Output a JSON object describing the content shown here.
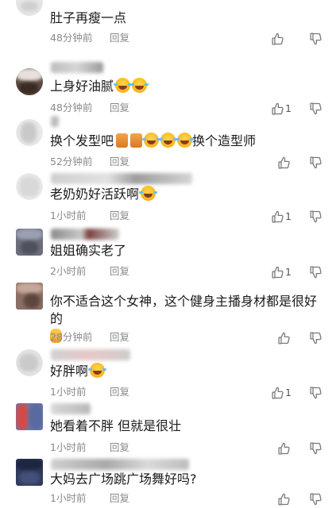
{
  "comments": [
    {
      "text": "肚子再瘦一点",
      "time": "48分钟前",
      "reply": "回复",
      "likes": ""
    },
    {
      "text": "上身好油腻",
      "time": "48分钟前",
      "reply": "回复",
      "likes": "1"
    },
    {
      "text_a": "换个发型吧",
      "text_b": "换个造型师",
      "time": "52分钟前",
      "reply": "回复",
      "likes": ""
    },
    {
      "text": "老奶奶好活跃啊",
      "time": "1小时前",
      "reply": "回复",
      "likes": "1"
    },
    {
      "text": "姐姐确实老了",
      "time": "2小时前",
      "reply": "回复",
      "likes": "1"
    },
    {
      "text": "你不适合这个女神，这个健身主播身材都是很好的",
      "time": "28分钟前",
      "reply": "回复",
      "likes": ""
    },
    {
      "text": "好胖啊",
      "time": "1小时前",
      "reply": "回复",
      "likes": "1"
    },
    {
      "text": "她看着不胖 但就是很壮",
      "time": "1小时前",
      "reply": "回复",
      "likes": ""
    },
    {
      "text": "大妈去广场跳广场舞好吗?",
      "time": "1小时前",
      "reply": "回复",
      "likes": ""
    }
  ],
  "icons": {
    "like": "thumbs-up-icon",
    "dislike": "thumbs-down-icon",
    "emoji_laugh": "laughing-crying-emoji-icon",
    "emoji_fan": "fan-emoji-icon",
    "emoji_thumb": "thumbs-up-emoji-icon"
  },
  "colors": {
    "meta_text": "#8a8a8a",
    "body_text": "#1a1a1a",
    "icon": "#777777"
  }
}
